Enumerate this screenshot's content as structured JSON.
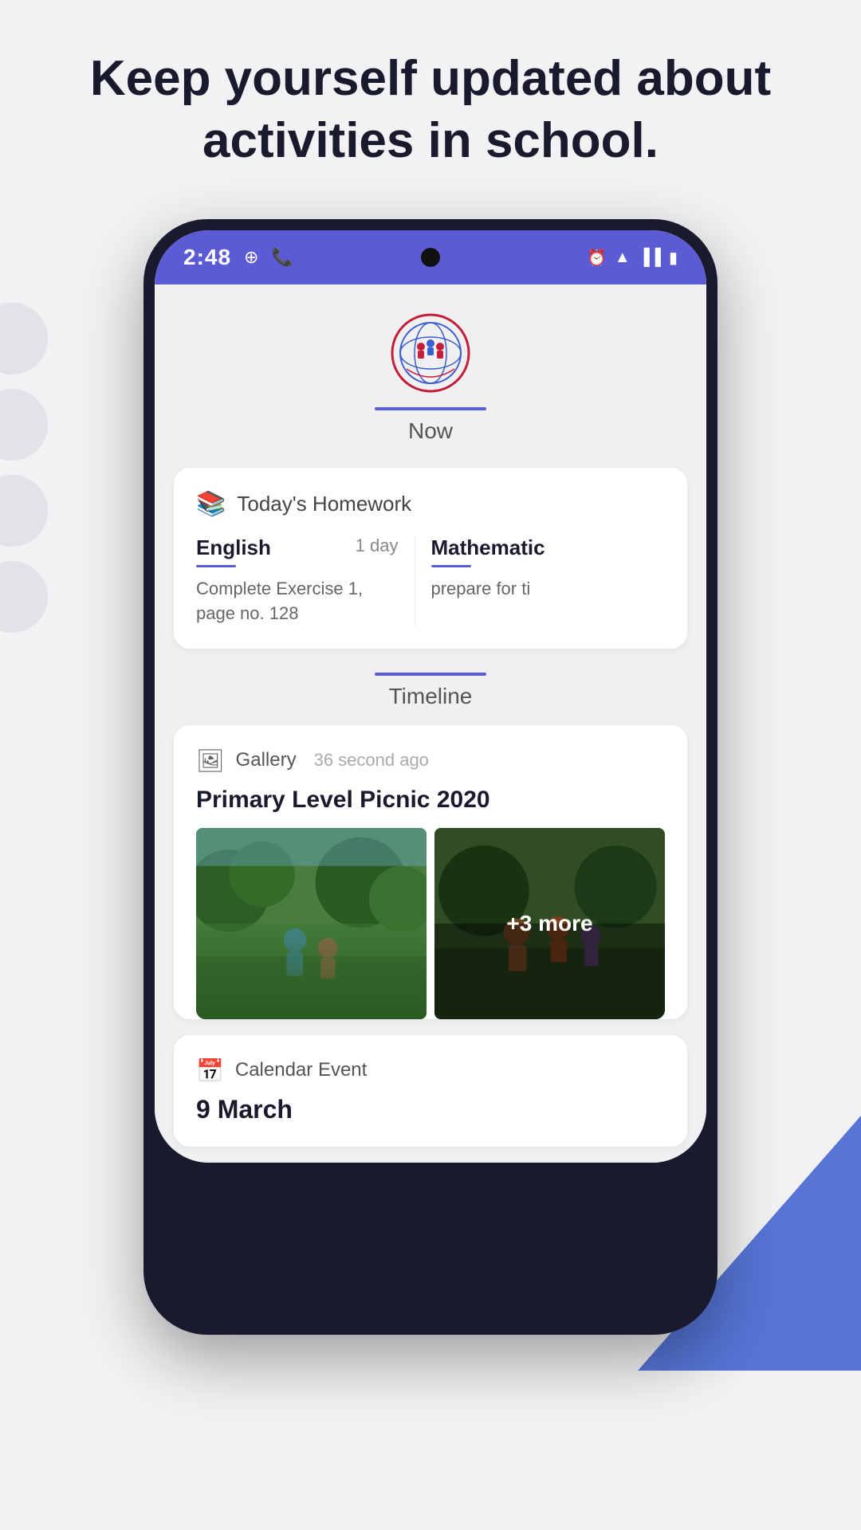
{
  "hero": {
    "title": "Keep yourself updated about activities in school."
  },
  "statusBar": {
    "time": "2:48",
    "leftIcons": [
      "maps-icon",
      "whatsapp-icon"
    ],
    "rightIcons": [
      "alarm-icon",
      "wifi-icon",
      "signal-icon",
      "battery-icon"
    ]
  },
  "appHeader": {
    "nowLabel": "Now"
  },
  "homeworkCard": {
    "sectionTitle": "Today's Homework",
    "subjects": [
      {
        "name": "English",
        "due": "1 day",
        "task": "Complete Exercise 1, page no. 128"
      },
      {
        "name": "Mathematic",
        "due": "",
        "task": "prepare for ti"
      }
    ]
  },
  "timeline": {
    "label": "Timeline",
    "cards": [
      {
        "type": "Gallery",
        "time": "36 second ago",
        "title": "Primary Level Picnic 2020",
        "moreCount": "+3 more"
      },
      {
        "type": "Calendar Event",
        "date": "9 March"
      }
    ]
  }
}
